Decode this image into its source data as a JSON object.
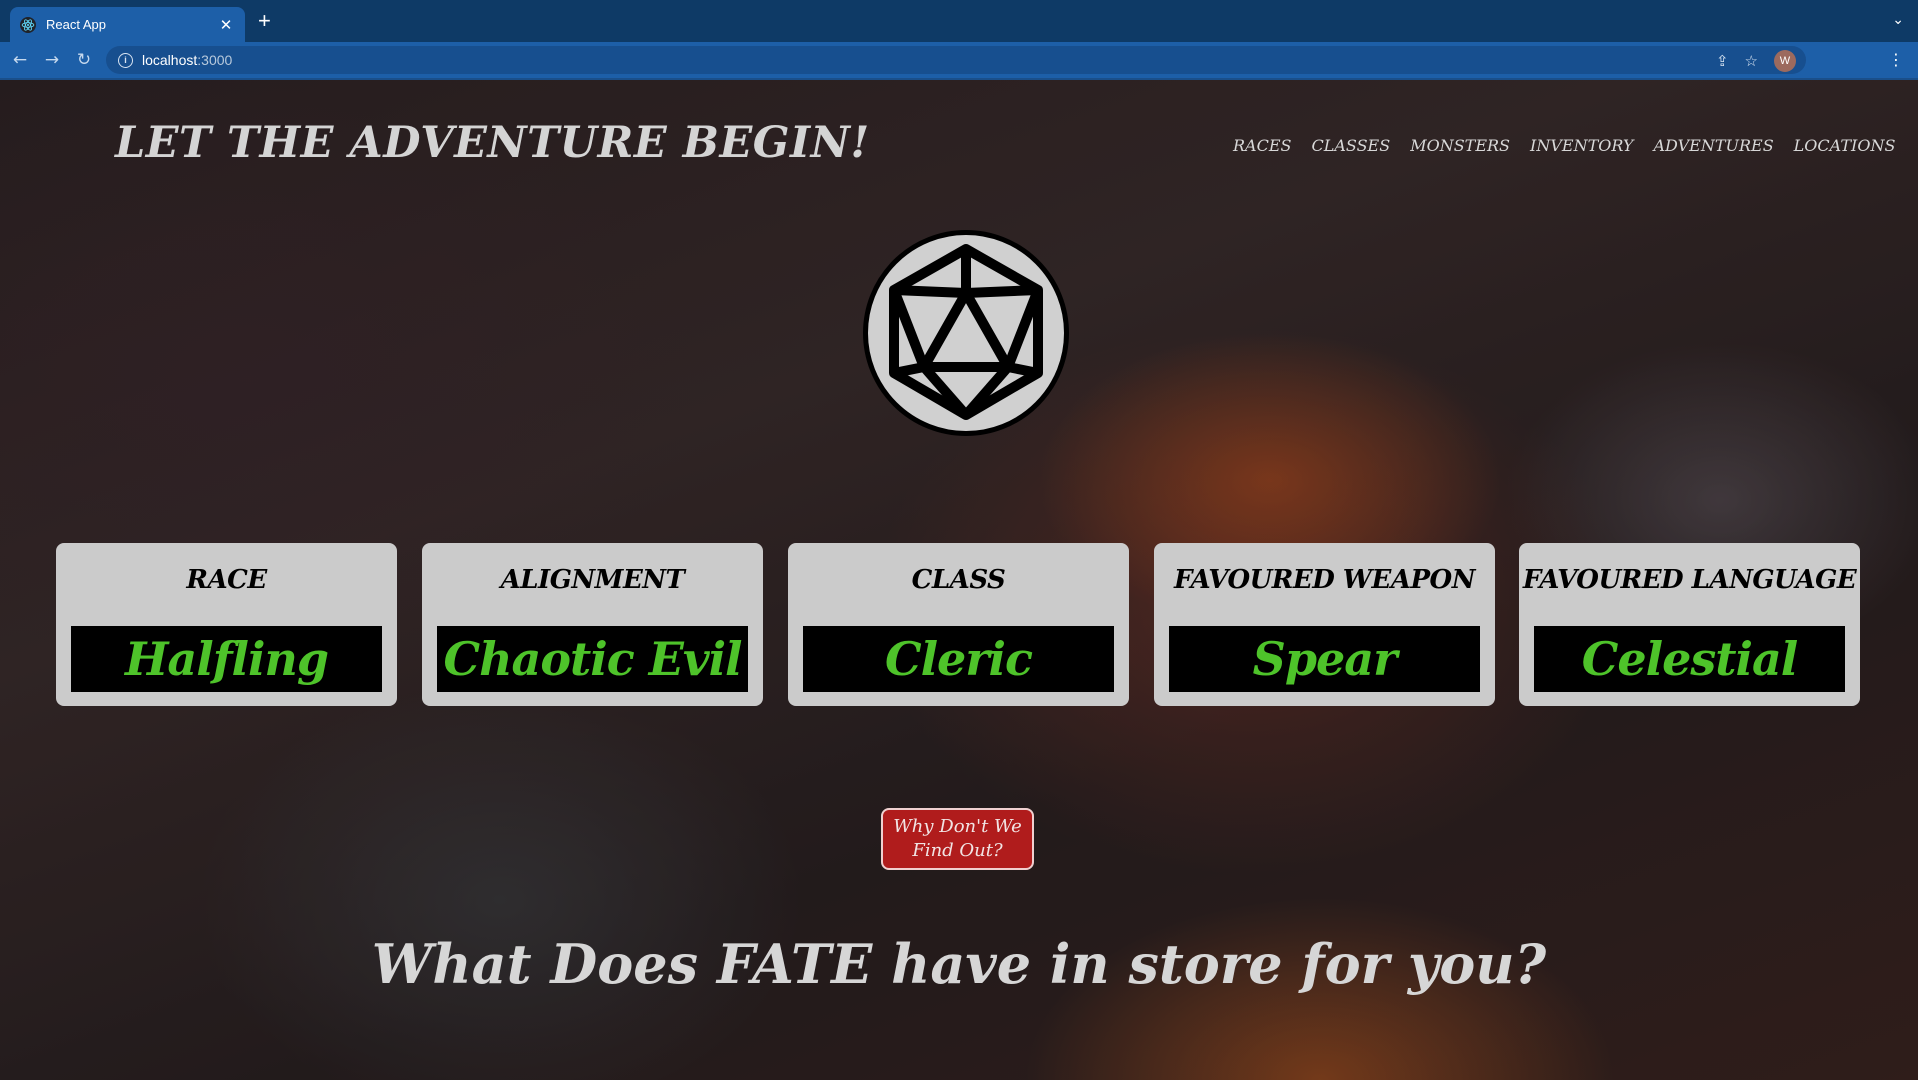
{
  "browser": {
    "tab_title": "React App",
    "url_host": "localhost",
    "url_port": ":3000",
    "profile_initial": "W"
  },
  "header": {
    "title": "LET THE ADVENTURE BEGIN!",
    "nav": [
      "RACES",
      "CLASSES",
      "MONSTERS",
      "INVENTORY",
      "ADVENTURES",
      "LOCATIONS"
    ]
  },
  "cards": [
    {
      "label": "RACE",
      "value": "Halfling"
    },
    {
      "label": "ALIGNMENT",
      "value": "Chaotic Evil"
    },
    {
      "label": "CLASS",
      "value": "Cleric"
    },
    {
      "label": "FAVOURED WEAPON",
      "value": "Spear"
    },
    {
      "label": "FAVOURED LANGUAGE",
      "value": "Celestial"
    }
  ],
  "cta": {
    "line1": "Why Don't We",
    "line2": "Find Out?"
  },
  "tagline": "What Does FATE have in store for you?",
  "colors": {
    "accent_green": "#4ec32a",
    "button_red": "#b01c1c",
    "card_bg": "#cbcbcb"
  }
}
